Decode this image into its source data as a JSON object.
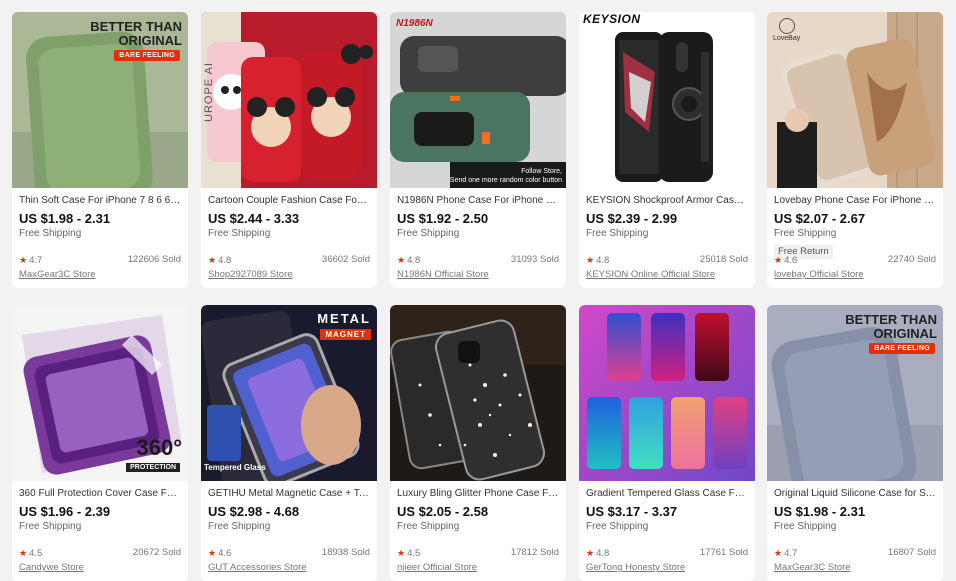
{
  "products": [
    {
      "title": "Thin Soft Case For iPhone 7 8 6 6s ...",
      "price": "US $1.98 - 2.31",
      "shipping": "Free Shipping",
      "rating": "4.7",
      "sold": "122606 Sold",
      "store": "MaxGear3C Store",
      "image_text": [
        "BETTER THAN",
        "ORIGINAL",
        "BARE FEELING"
      ],
      "image_colors": {
        "bg": "#aab898",
        "case": "#7fa06a"
      }
    },
    {
      "title": "Cartoon Couple Fashion Case For i...",
      "price": "US $2.44 - 3.33",
      "shipping": "Free Shipping",
      "rating": "4.8",
      "sold": "36602 Sold",
      "store": "Shop2927089 Store",
      "image_text": [
        "UROPE AI"
      ],
      "image_colors": {
        "bg": "#b81b2a",
        "case": "#d8212f"
      }
    },
    {
      "title": "N1986N Phone Case For iPhone 1...",
      "price": "US $1.92 - 2.50",
      "shipping": "Free Shipping",
      "rating": "4.8",
      "sold": "31093 Sold",
      "store": "N1986N Official Store",
      "image_text": [
        "N1986N",
        "Follow Store,",
        "Send one more random color button"
      ],
      "image_colors": {
        "bg": "#d6d6d6",
        "case": "#3e3e3e"
      }
    },
    {
      "title": "KEYSION Shockproof Armor Case F...",
      "price": "US $2.39 - 2.99",
      "shipping": "Free Shipping",
      "rating": "4.8",
      "sold": "25018 Sold",
      "store": "KEYSION Online Official Store",
      "image_text": [
        "KEYSION"
      ],
      "image_colors": {
        "bg": "#ffffff",
        "case": "#1b1b1b"
      }
    },
    {
      "title": "Lovebay Phone Case For iPhone 1...",
      "price": "US $2.07 - 2.67",
      "shipping": "Free Shipping",
      "extra_badge": "Free Return",
      "rating": "4.6",
      "sold": "22740 Sold",
      "store": "lovebay Official Store",
      "image_text": [
        "LoveBay"
      ],
      "image_colors": {
        "bg": "#e8d8c8",
        "case": "#d8bfa8"
      }
    },
    {
      "title": "360 Full Protection Cover Case For ...",
      "price": "US $1.96 - 2.39",
      "shipping": "Free Shipping",
      "rating": "4.5",
      "sold": "20672 Sold",
      "store": "Candywe Store",
      "image_text": [
        "360°",
        "PROTECTION"
      ],
      "image_colors": {
        "bg": "#f4f4f4",
        "case": "#7a3a9a"
      }
    },
    {
      "title": "GETIHU Metal Magnetic Case + Te...",
      "price": "US $2.98 - 4.68",
      "shipping": "Free Shipping",
      "rating": "4.6",
      "sold": "18938 Sold",
      "store": "GUT Accessories Store",
      "image_text": [
        "METAL",
        "MAGNET",
        "Tempered Glass"
      ],
      "image_colors": {
        "bg": "#1a1a2e",
        "case": "#5060d0"
      }
    },
    {
      "title": "Luxury Bling Glitter Phone Case Fo...",
      "price": "US $2.05 - 2.58",
      "shipping": "Free Shipping",
      "rating": "4.5",
      "sold": "17812 Sold",
      "store": "njieer Official Store",
      "image_text": [],
      "image_colors": {
        "bg": "#1e1a18",
        "case": "#2a2a2a"
      }
    },
    {
      "title": "Gradient Tempered Glass Case For...",
      "price": "US $3.17 - 3.37",
      "shipping": "Free Shipping",
      "rating": "4.8",
      "sold": "17761 Sold",
      "store": "GerTong Honesty Store",
      "image_text": [],
      "image_colors": {
        "bg": "#b844c8",
        "case": "#3050c0"
      }
    },
    {
      "title": "Original Liquid Silicone Case for Sa...",
      "price": "US $1.98 - 2.31",
      "shipping": "Free Shipping",
      "rating": "4.7",
      "sold": "16807 Sold",
      "store": "MaxGear3C Store",
      "image_text": [
        "BETTER THAN",
        "ORIGINAL",
        "BARE FEELING"
      ],
      "image_colors": {
        "bg": "#a8aec0",
        "case": "#8890a8"
      }
    }
  ],
  "icons": {
    "rating": "star-icon"
  },
  "accent_color": "#e62e04"
}
